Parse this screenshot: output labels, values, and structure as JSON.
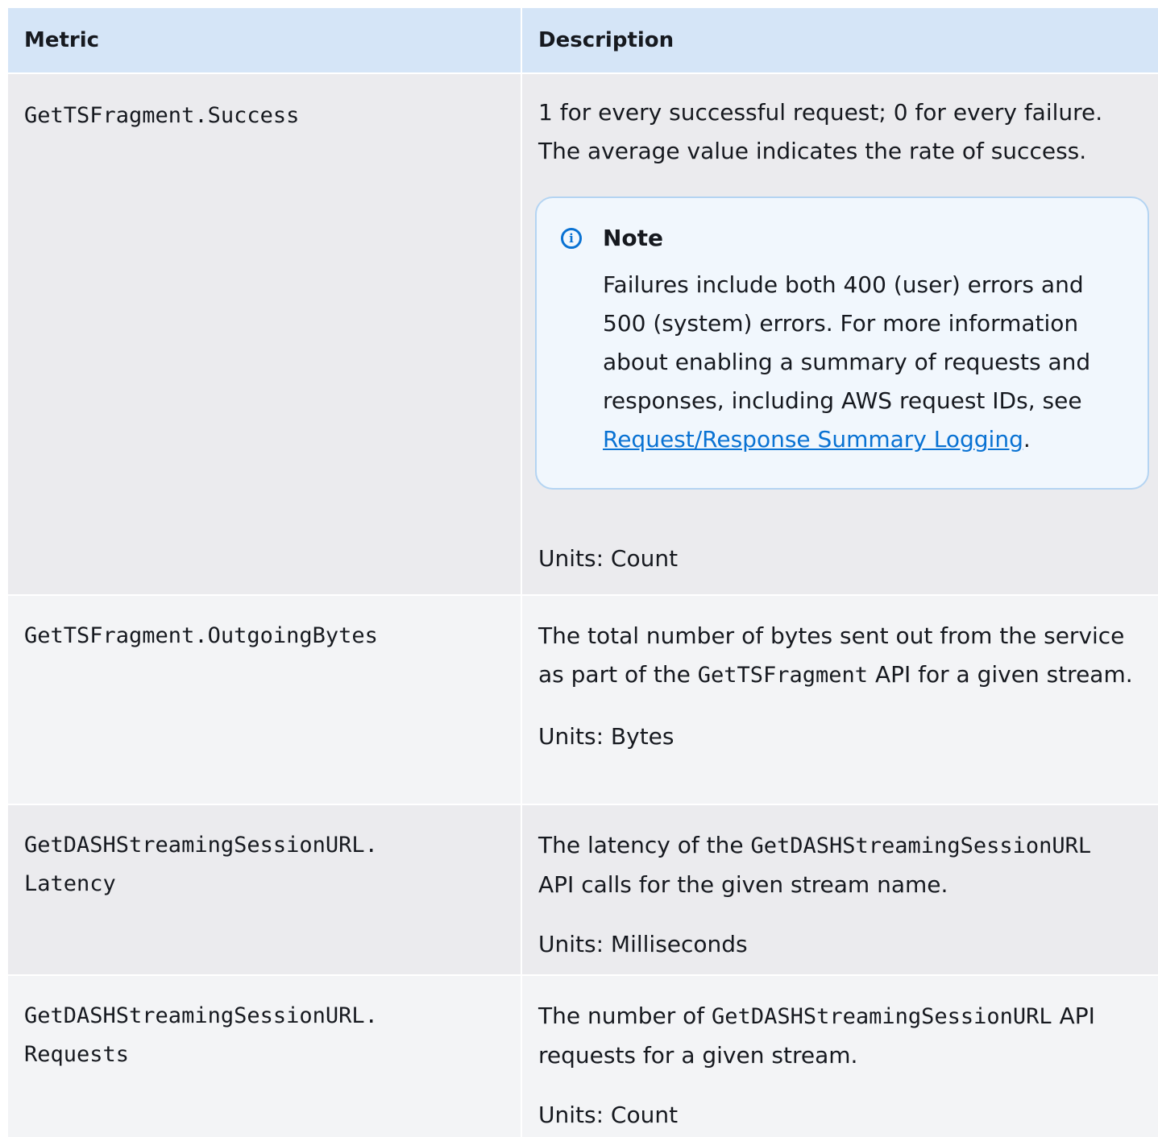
{
  "table": {
    "headers": {
      "metric": "Metric",
      "description": "Description"
    },
    "rows": [
      {
        "metric": "GetTSFragment.Success",
        "desc_line1": "1 for every successful request; 0 for every failure.",
        "desc_line2": "The average value indicates the rate of success.",
        "note": {
          "title": "Note",
          "text": "Failures include both 400 (user) errors and 500 (system) errors. For more information about enabling a summary of requests and responses, including AWS request IDs, see ",
          "link": "Request/Response Summary Logging",
          "after_link": "."
        },
        "units": "Units: Count"
      },
      {
        "metric": "GetTSFragment.OutgoingBytes",
        "desc_pre": "The total number of bytes sent out from the service as part of the ",
        "desc_code": "GetTSFragment",
        "desc_post": " API for a given stream.",
        "units": "Units: Bytes"
      },
      {
        "metric_line1": "GetDASHStreamingSessionURL.",
        "metric_line2": "Latency",
        "desc_pre": "The latency of the ",
        "desc_code": "GetDASHStreamingSessionURL",
        "desc_post": " API calls for the given stream name.",
        "units": "Units: Milliseconds"
      },
      {
        "metric_line1": "GetDASHStreamingSessionURL.",
        "metric_line2": "Requests",
        "desc_pre": "The number of ",
        "desc_code": "GetDASHStreamingSessionURL",
        "desc_post": " API requests for a given stream.",
        "units": "Units: Count"
      }
    ]
  }
}
